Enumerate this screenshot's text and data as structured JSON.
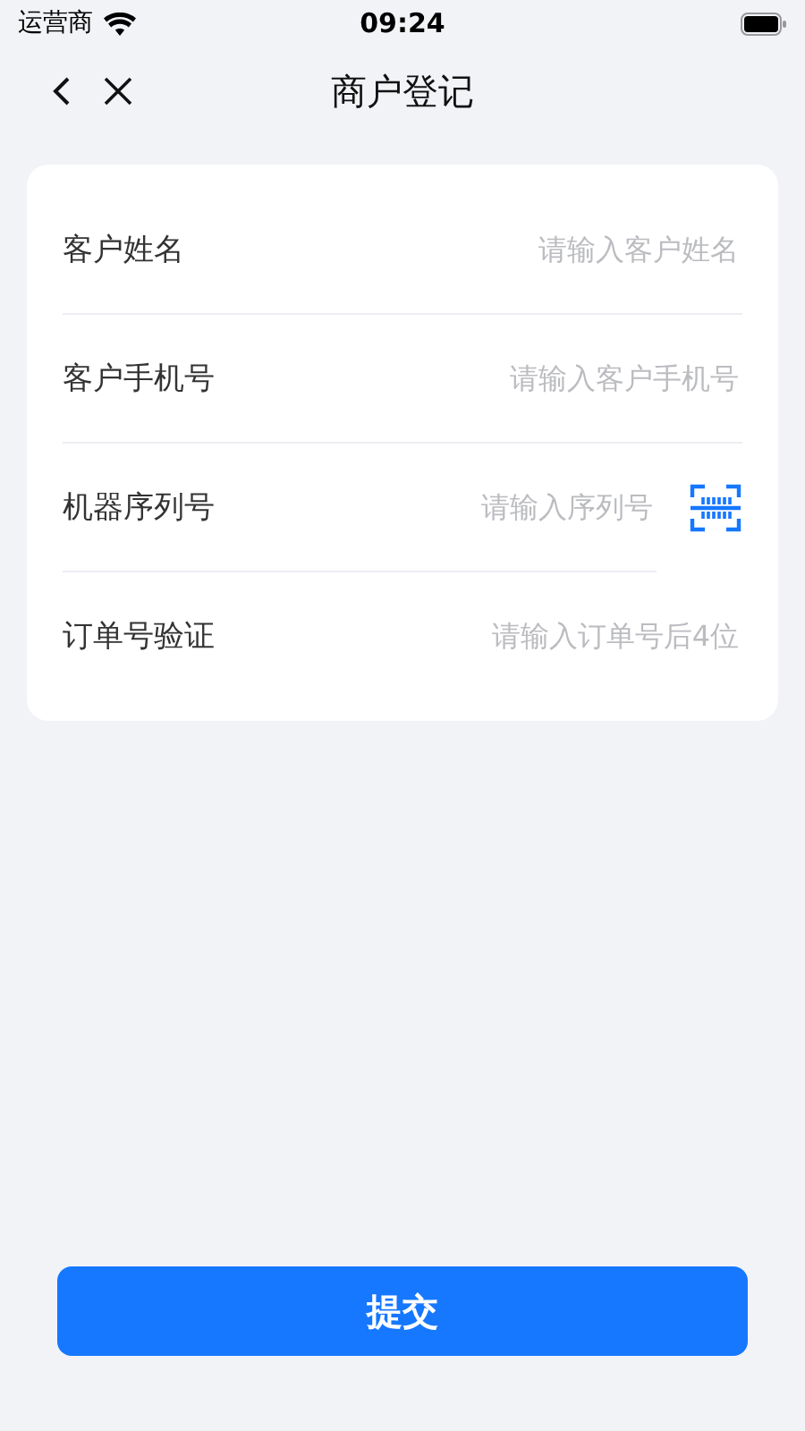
{
  "status_bar": {
    "carrier": "运营商",
    "time": "09:24"
  },
  "nav": {
    "title": "商户登记"
  },
  "fields": [
    {
      "kind": "text",
      "label": "客户姓名",
      "placeholder": "请输入客户姓名"
    },
    {
      "kind": "text",
      "label": "客户手机号",
      "placeholder": "请输入客户手机号"
    },
    {
      "kind": "scan",
      "label": "机器序列号",
      "placeholder": "请输入序列号"
    },
    {
      "kind": "text",
      "label": "订单号验证",
      "placeholder": "请输入订单号后4位"
    }
  ],
  "submit": {
    "label": "提交"
  }
}
